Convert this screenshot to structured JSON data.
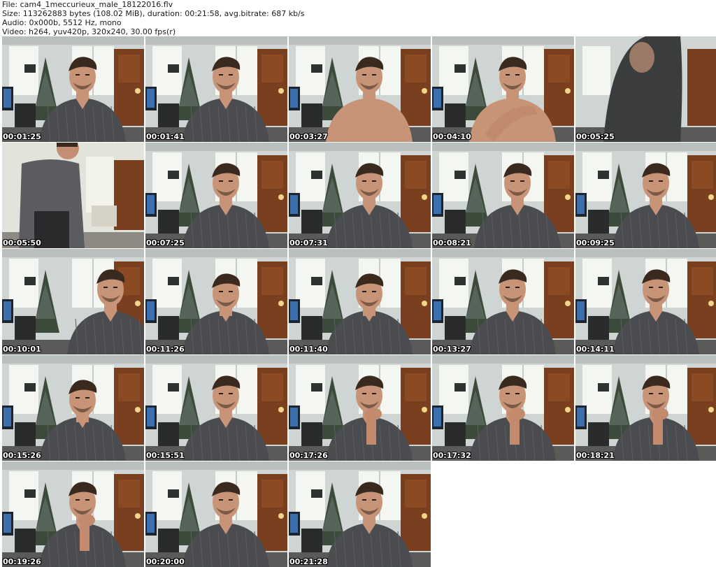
{
  "header": {
    "file_line": "File: cam4_1meccurieux_male_18122016.flv",
    "size_line": "Size: 113262883 bytes (108.02 MiB), duration: 00:21:58, avg.bitrate: 687 kb/s",
    "audio_line": "Audio: 0x000b, 5512 Hz, mono",
    "video_line": "Video: h264, yuv420p, 320x240, 30.00 fps(r)"
  },
  "thumbnails": [
    {
      "timestamp": "00:01:25",
      "scene": "shirt"
    },
    {
      "timestamp": "00:01:41",
      "scene": "shirt"
    },
    {
      "timestamp": "00:03:27",
      "scene": "shirtless"
    },
    {
      "timestamp": "00:04:10",
      "scene": "shirtless-arm"
    },
    {
      "timestamp": "00:05:25",
      "scene": "blur"
    },
    {
      "timestamp": "00:05:50",
      "scene": "standing"
    },
    {
      "timestamp": "00:07:25",
      "scene": "shirt"
    },
    {
      "timestamp": "00:07:31",
      "scene": "shirt"
    },
    {
      "timestamp": "00:08:21",
      "scene": "shirt-tilt"
    },
    {
      "timestamp": "00:09:25",
      "scene": "shirt"
    },
    {
      "timestamp": "00:10:01",
      "scene": "shirt-right"
    },
    {
      "timestamp": "00:11:26",
      "scene": "shirt-down"
    },
    {
      "timestamp": "00:11:40",
      "scene": "shirt-down"
    },
    {
      "timestamp": "00:13:27",
      "scene": "shirt"
    },
    {
      "timestamp": "00:14:11",
      "scene": "shirt"
    },
    {
      "timestamp": "00:15:26",
      "scene": "shirt-down"
    },
    {
      "timestamp": "00:15:51",
      "scene": "shirt"
    },
    {
      "timestamp": "00:17:26",
      "scene": "hand-chin"
    },
    {
      "timestamp": "00:17:32",
      "scene": "hand-chin"
    },
    {
      "timestamp": "00:18:21",
      "scene": "hand-chin"
    },
    {
      "timestamp": "00:19:26",
      "scene": "hand-chin"
    },
    {
      "timestamp": "00:20:00",
      "scene": "shirt"
    },
    {
      "timestamp": "00:21:28",
      "scene": "shirt"
    }
  ],
  "colors": {
    "wall": "#d8dcd8",
    "window": "#f4f6f2",
    "cabinet": "#7a3f1e",
    "tree": "#3c4a3a",
    "shirt": "#4a4c50",
    "skin": "#c89478",
    "hair": "#3a2a1e",
    "floor": "#5a5a58"
  }
}
